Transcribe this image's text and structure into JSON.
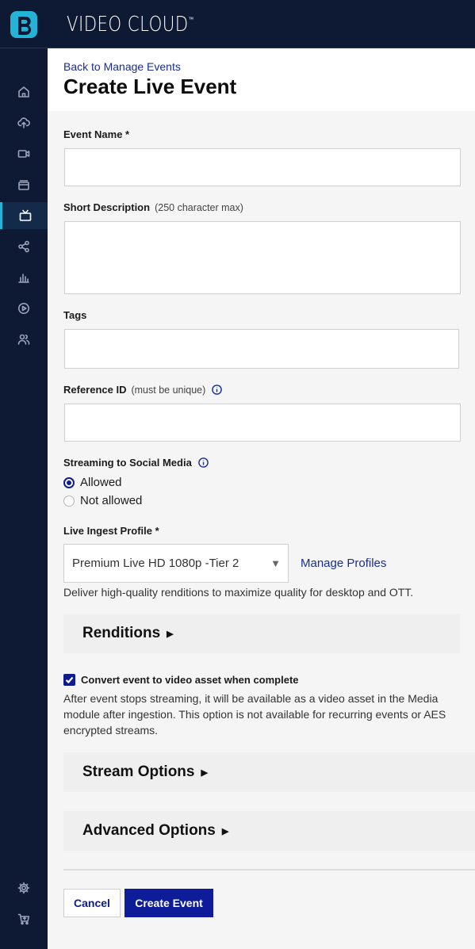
{
  "app": {
    "brand": "VIDEO CLOUD",
    "trademark": "™",
    "logo_icon": "brightcove-logo-icon",
    "colors": {
      "nav_bg": "#0e1934",
      "accent": "#24b3d6",
      "primary": "#0e1c9a",
      "link": "#1a2d8f"
    }
  },
  "sidebar": {
    "items": [
      {
        "icon": "home-icon"
      },
      {
        "icon": "upload-icon"
      },
      {
        "icon": "video-camera-icon"
      },
      {
        "icon": "media-library-icon"
      },
      {
        "icon": "live-tv-icon",
        "active": true
      },
      {
        "icon": "share-icon"
      },
      {
        "icon": "analytics-icon"
      },
      {
        "icon": "player-icon"
      },
      {
        "icon": "users-icon"
      }
    ],
    "bottom": [
      {
        "icon": "gear-icon"
      },
      {
        "icon": "cart-icon"
      }
    ]
  },
  "header": {
    "back_link": "Back to Manage Events",
    "title": "Create Live Event"
  },
  "form": {
    "event_name": {
      "label": "Event Name *",
      "value": ""
    },
    "short_description": {
      "label": "Short Description",
      "hint": "(250 character max)",
      "value": ""
    },
    "tags": {
      "label": "Tags",
      "value": ""
    },
    "reference_id": {
      "label": "Reference ID",
      "hint": "(must be unique)",
      "value": ""
    },
    "social_media": {
      "label": "Streaming to Social Media",
      "options": [
        {
          "label": "Allowed",
          "selected": true
        },
        {
          "label": "Not allowed",
          "selected": false
        }
      ]
    },
    "ingest_profile": {
      "label": "Live Ingest Profile *",
      "selected": "Premium Live HD 1080p -Tier 2",
      "manage_link": "Manage Profiles",
      "description": "Deliver high-quality renditions to maximize quality for desktop and OTT."
    },
    "renditions": {
      "label": "Renditions",
      "expanded": false
    },
    "convert": {
      "checked": true,
      "label": "Convert event to video asset when complete",
      "description": "After event stops streaming, it will be available as a video asset in the Media module after ingestion. This option is not available for recurring events or AES encrypted streams."
    },
    "stream_options": {
      "label": "Stream Options",
      "expanded": false
    },
    "advanced_options": {
      "label": "Advanced Options",
      "expanded": false
    }
  },
  "actions": {
    "cancel": "Cancel",
    "create": "Create Event"
  }
}
